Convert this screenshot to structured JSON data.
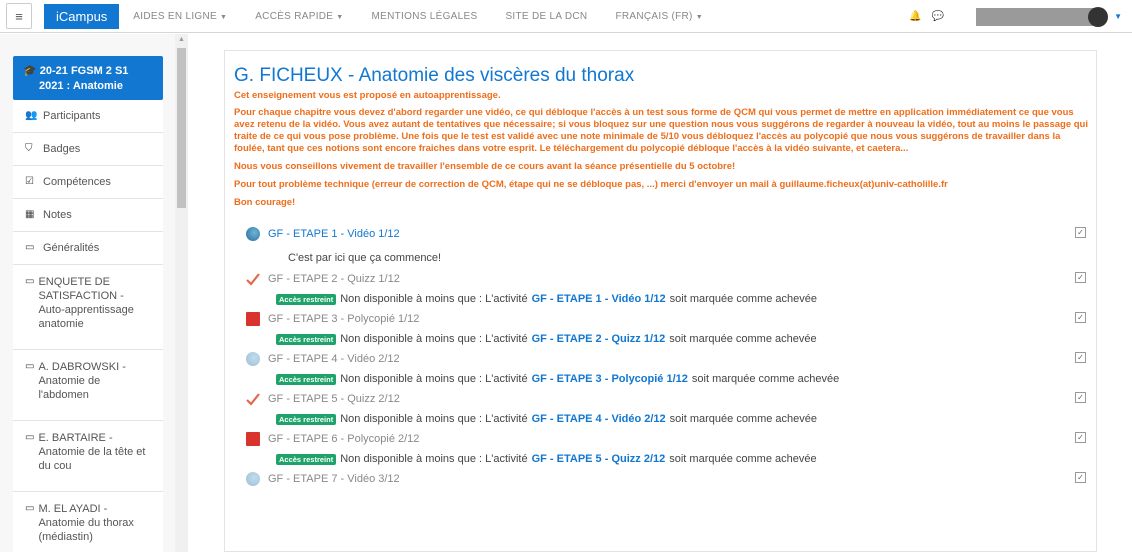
{
  "topbar": {
    "brand": "iCampus",
    "links": [
      "AIDES EN LIGNE",
      "ACCÈS RAPIDE",
      "MENTIONS LÉGALES",
      "SITE DE LA DCN",
      "FRANÇAIS (FR)"
    ]
  },
  "sidebar": {
    "course_line1": "20-21 FGSM 2 S1",
    "course_line2": "2021 : Anatomie",
    "items": [
      {
        "label": "Participants",
        "icon": "users-icon"
      },
      {
        "label": "Badges",
        "icon": "shield-icon"
      },
      {
        "label": "Compétences",
        "icon": "checkbox-icon"
      },
      {
        "label": "Notes",
        "icon": "table-icon"
      },
      {
        "label": "Généralités",
        "icon": "folder-icon"
      },
      {
        "label": "ENQUETE DE SATISFACTION - Auto-apprentissage anatomie",
        "icon": "folder-icon"
      },
      {
        "label": "A. DABROWSKI - Anatomie de l'abdomen",
        "icon": "folder-icon"
      },
      {
        "label": "E. BARTAIRE - Anatomie de la tête et du cou",
        "icon": "folder-icon"
      },
      {
        "label": "M. EL AYADI - Anatomie du thorax (médiastin)",
        "icon": "folder-icon"
      }
    ]
  },
  "main": {
    "title": "G. FICHEUX - Anatomie des viscères du thorax",
    "notices": [
      "Cet enseignement vous est proposé en autoapprentissage.",
      "Pour chaque chapitre vous devez d'abord regarder une vidéo, ce qui débloque l'accès à un test sous forme de QCM qui vous permet de mettre en application immédiatement ce que vous avez retenu de la vidéo. Vous avez autant de tentatives que nécessaire; si vous bloquez sur une question nous vous suggérons de regarder à nouveau la vidéo, tout au moins le passage qui traite de ce qui vous pose problème. Une fois que le test est validé avec une note minimale de 5/10 vous débloquez l'accès au polycopié que nous vous suggérons de travailler dans la foulée, tant que ces notions sont encore fraiches dans votre esprit. Le téléchargement du polycopié débloque l'accès à la vidéo suivante, et caetera...",
      "Nous vous conseillons vivement de travailler l'ensemble de ce cours avant la séance présentielle du 5 octobre!",
      "Pour tout problème technique (erreur de correction de QCM, étape qui ne se débloque pas, ...) merci d'envoyer un mail à guillaume.ficheux(at)univ-catholille.fr",
      "Bon courage!"
    ],
    "restriction_badge": "Accès restreint",
    "restriction_prefix": "Non disponible à moins que : L'activité",
    "restriction_suffix": "soit marquée comme achevée",
    "activities": [
      {
        "label": "GF - ETAPE 1 - Vidéo 1/12",
        "type": "video",
        "description": "C'est par ici que ça commence!"
      },
      {
        "label": "GF - ETAPE 2 - Quizz 1/12",
        "type": "quizz",
        "requires": "GF - ETAPE 1 - Vidéo 1/12"
      },
      {
        "label": "GF - ETAPE 3 - Polycopié 1/12",
        "type": "pdf",
        "requires": "GF - ETAPE 2 - Quizz 1/12"
      },
      {
        "label": "GF - ETAPE 4 - Vidéo 2/12",
        "type": "video",
        "requires": "GF - ETAPE 3 - Polycopié 1/12"
      },
      {
        "label": "GF - ETAPE 5 - Quizz 2/12",
        "type": "quizz",
        "requires": "GF - ETAPE 4 - Vidéo 2/12"
      },
      {
        "label": "GF - ETAPE 6 - Polycopié 2/12",
        "type": "pdf",
        "requires": "GF - ETAPE 5 - Quizz 2/12"
      },
      {
        "label": "GF - ETAPE 7 - Vidéo 3/12",
        "type": "video"
      }
    ]
  }
}
